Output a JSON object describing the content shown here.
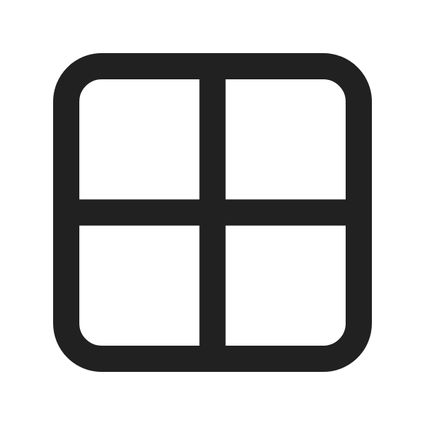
{
  "icon": {
    "name": "grid-2x2-icon",
    "stroke_color": "#212121",
    "background_color": "#ffffff"
  }
}
